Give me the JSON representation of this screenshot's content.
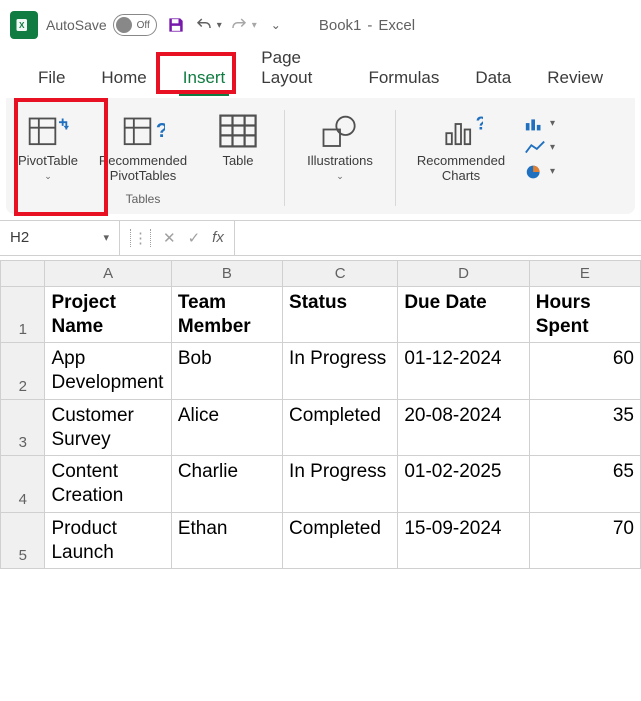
{
  "title": {
    "autosave": "AutoSave",
    "toggle_state": "Off",
    "book": "Book1",
    "app": "Excel",
    "sep": "-"
  },
  "tabs": {
    "file": "File",
    "home": "Home",
    "insert": "Insert",
    "page_layout": "Page Layout",
    "formulas": "Formulas",
    "data": "Data",
    "review": "Review"
  },
  "ribbon": {
    "pivot": "PivotTable",
    "recommended_pivot": "Recommended PivotTables",
    "table": "Table",
    "tables_group": "Tables",
    "illustrations": "Illustrations",
    "recommended_charts": "Recommended Charts"
  },
  "namebox": "H2",
  "fx": "fx",
  "columns": [
    "A",
    "B",
    "C",
    "D",
    "E"
  ],
  "headers": {
    "A": "Project Name",
    "B": "Team Member",
    "C": "Status",
    "D": "Due Date",
    "E": "Hours Spent"
  },
  "rows": [
    {
      "n": "2",
      "A": "App Development",
      "B": "Bob",
      "C": "In Progress",
      "D": "01-12-2024",
      "E": "60"
    },
    {
      "n": "3",
      "A": "Customer Survey",
      "B": "Alice",
      "C": "Completed",
      "D": "20-08-2024",
      "E": "35"
    },
    {
      "n": "4",
      "A": "Content Creation",
      "B": "Charlie",
      "C": "In Progress",
      "D": "01-02-2025",
      "E": "65"
    },
    {
      "n": "5",
      "A": "Product Launch",
      "B": "Ethan",
      "C": "Completed",
      "D": "15-09-2024",
      "E": "70"
    }
  ]
}
